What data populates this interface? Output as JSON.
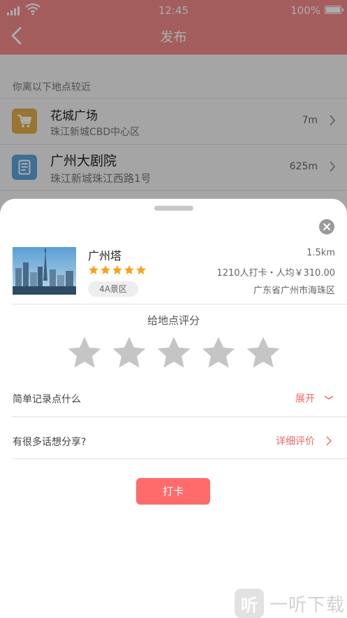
{
  "status_bar": {
    "time": "12:45",
    "battery": "100%"
  },
  "header": {
    "title": "发布",
    "back_icon": "chevron-left-icon"
  },
  "nearby": {
    "hint": "你离以下地点较近",
    "places": [
      {
        "name": "花城广场",
        "address": "珠江新城CBD中心区",
        "distance": "7m",
        "icon": "shopping-cart-icon",
        "icon_color": "#e0ad48"
      },
      {
        "name": "广州大剧院",
        "address": "珠江新城珠江西路1号",
        "distance": "625m",
        "icon": "book-icon",
        "icon_color": "#5aa2dc"
      }
    ]
  },
  "poi": {
    "name": "广州塔",
    "distance": "1.5km",
    "stats": "1210人打卡・人均￥310.00",
    "area": "广东省广州市海珠区",
    "tag": "4A景区",
    "rating_stars": 5,
    "star_color": "#f7a31c"
  },
  "rating": {
    "title": "给地点评分",
    "stars": 5,
    "selected": 0,
    "empty_color": "#c5c5c5"
  },
  "options": [
    {
      "label": "简单记录点什么",
      "action": "展开",
      "icon": "chevron-down-icon"
    },
    {
      "label": "有很多话想分享?",
      "action": "详细评价",
      "icon": "chevron-right-icon"
    }
  ],
  "checkin": {
    "label": "打卡"
  },
  "watermark": {
    "logo": "听",
    "text": "一听下载"
  },
  "colors": {
    "header": "#f08a8a",
    "accent": "#f06767",
    "button": "#ff6b6b"
  }
}
